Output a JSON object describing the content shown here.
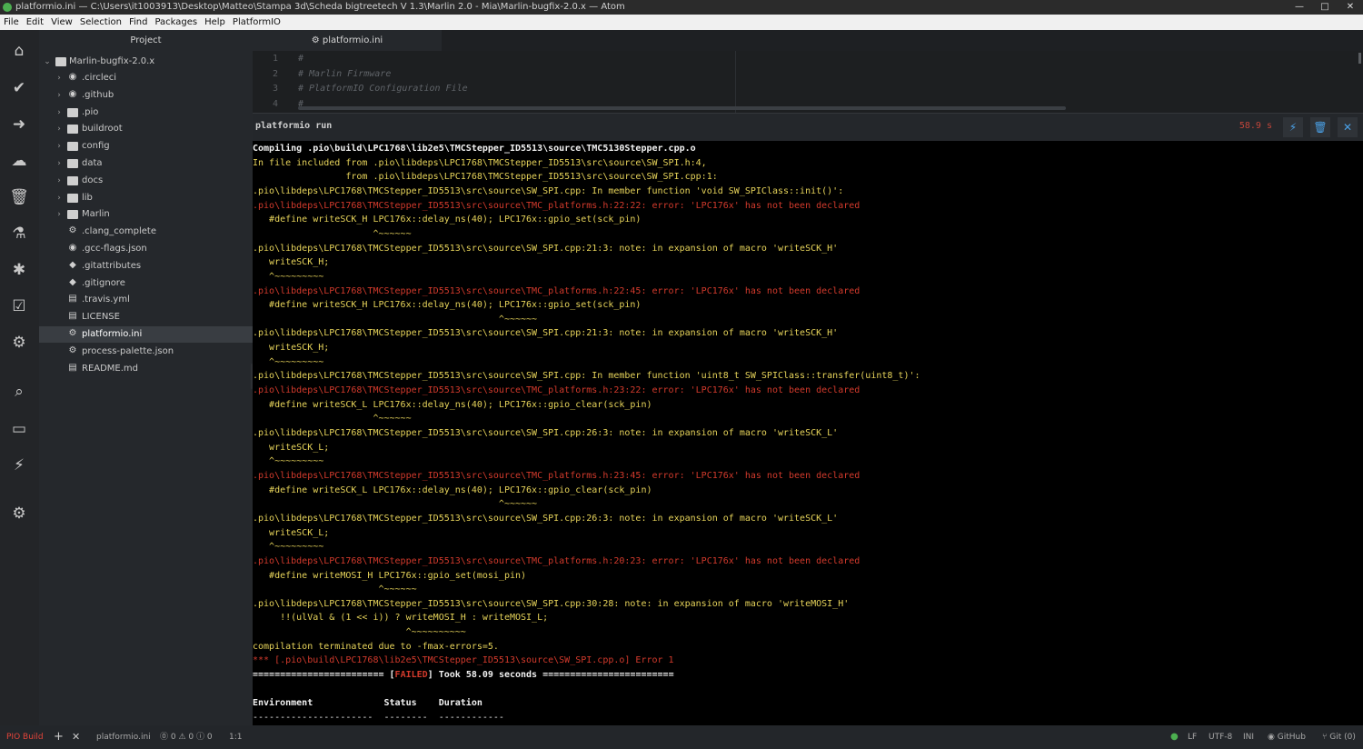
{
  "window": {
    "title": "platformio.ini — C:\\Users\\it1003913\\Desktop\\Matteo\\Stampa 3d\\Scheda bigtreetech V 1.3\\Marlin 2.0 - Mia\\Marlin-bugfix-2.0.x — Atom",
    "controls": [
      "—",
      "□",
      "✕"
    ]
  },
  "menu": [
    "File",
    "Edit",
    "View",
    "Selection",
    "Find",
    "Packages",
    "Help",
    "PlatformIO"
  ],
  "activity_icons": [
    {
      "name": "home-icon",
      "glyph": "⌂"
    },
    {
      "name": "build-check-icon",
      "glyph": "✔"
    },
    {
      "name": "upload-arrow-icon",
      "glyph": "➜"
    },
    {
      "name": "cloud-upload-icon",
      "glyph": "☁"
    },
    {
      "name": "trash-clean-icon",
      "glyph": "🗑"
    },
    {
      "name": "test-flask-icon",
      "glyph": "⚗"
    },
    {
      "name": "debug-bug-icon",
      "glyph": "✱"
    },
    {
      "name": "check-list-icon",
      "glyph": "☑"
    },
    {
      "name": "device-icon",
      "glyph": "⚙"
    },
    {
      "name": "search-icon",
      "glyph": "⌕"
    },
    {
      "name": "terminal-icon",
      "glyph": "▭"
    },
    {
      "name": "plug-icon",
      "glyph": "⚡"
    },
    {
      "name": "settings-gear-icon",
      "glyph": "⚙"
    }
  ],
  "project": {
    "header": "Project",
    "root": "Marlin-bugfix-2.0.x",
    "items": [
      {
        "label": ".circleci",
        "type": "folder",
        "glyph": "◉"
      },
      {
        "label": ".github",
        "type": "folder",
        "glyph": "◉"
      },
      {
        "label": ".pio",
        "type": "folder"
      },
      {
        "label": "buildroot",
        "type": "folder"
      },
      {
        "label": "config",
        "type": "folder"
      },
      {
        "label": "data",
        "type": "folder"
      },
      {
        "label": "docs",
        "type": "folder"
      },
      {
        "label": "lib",
        "type": "folder"
      },
      {
        "label": "Marlin",
        "type": "folder"
      },
      {
        "label": ".clang_complete",
        "type": "file",
        "glyph": "⚙"
      },
      {
        "label": ".gcc-flags.json",
        "type": "file",
        "glyph": "◉"
      },
      {
        "label": ".gitattributes",
        "type": "file",
        "glyph": "◆"
      },
      {
        "label": ".gitignore",
        "type": "file",
        "glyph": "◆"
      },
      {
        "label": ".travis.yml",
        "type": "file",
        "glyph": "▤"
      },
      {
        "label": "LICENSE",
        "type": "file",
        "glyph": "▤"
      },
      {
        "label": "platformio.ini",
        "type": "file",
        "glyph": "⚙",
        "selected": true
      },
      {
        "label": "process-palette.json",
        "type": "file",
        "glyph": "⚙"
      },
      {
        "label": "README.md",
        "type": "file",
        "glyph": "▤"
      }
    ]
  },
  "editor": {
    "tab_label": "platformio.ini",
    "lines": [
      {
        "n": "1",
        "text": "#"
      },
      {
        "n": "2",
        "text": "# Marlin Firmware"
      },
      {
        "n": "3",
        "text": "# PlatformIO Configuration File"
      },
      {
        "n": "4",
        "text": "#"
      }
    ]
  },
  "terminal": {
    "title": "platformio run",
    "elapsed": "58.9 s",
    "buttons": [
      {
        "name": "run-terminal-button",
        "glyph": "⚡"
      },
      {
        "name": "clear-terminal-button",
        "glyph": "🗑"
      },
      {
        "name": "close-terminal-button",
        "glyph": "✕"
      }
    ],
    "colors": {
      "white": "#f2f2f2",
      "yellow": "#e6d35a",
      "red": "#d23a2c"
    },
    "lines": [
      {
        "text": "Compiling .pio\\build\\LPC1768\\lib2e5\\TMCStepper_ID5513\\source\\TMC5130Stepper.cpp.o",
        "color": "white",
        "bold": true
      },
      {
        "text": "In file included from .pio\\libdeps\\LPC1768\\TMCStepper_ID5513\\src\\source\\SW_SPI.h:4,",
        "color": "yellow"
      },
      {
        "text": "                 from .pio\\libdeps\\LPC1768\\TMCStepper_ID5513\\src\\source\\SW_SPI.cpp:1:",
        "color": "yellow"
      },
      {
        "text": ".pio\\libdeps\\LPC1768\\TMCStepper_ID5513\\src\\source\\SW_SPI.cpp: In member function 'void SW_SPIClass::init()':",
        "color": "yellow"
      },
      {
        "text": ".pio\\libdeps\\LPC1768\\TMCStepper_ID5513\\src\\source\\TMC_platforms.h:22:22: error: 'LPC176x' has not been declared",
        "color": "red"
      },
      {
        "text": "   #define writeSCK_H LPC176x::delay_ns(40); LPC176x::gpio_set(sck_pin)",
        "color": "yellow"
      },
      {
        "text": "                      ^~~~~~~",
        "color": "yellow"
      },
      {
        "text": ".pio\\libdeps\\LPC1768\\TMCStepper_ID5513\\src\\source\\SW_SPI.cpp:21:3: note: in expansion of macro 'writeSCK_H'",
        "color": "yellow"
      },
      {
        "text": "   writeSCK_H;",
        "color": "yellow"
      },
      {
        "text": "   ^~~~~~~~~~",
        "color": "yellow"
      },
      {
        "text": ".pio\\libdeps\\LPC1768\\TMCStepper_ID5513\\src\\source\\TMC_platforms.h:22:45: error: 'LPC176x' has not been declared",
        "color": "red"
      },
      {
        "text": "   #define writeSCK_H LPC176x::delay_ns(40); LPC176x::gpio_set(sck_pin)",
        "color": "yellow"
      },
      {
        "text": "                                             ^~~~~~~",
        "color": "yellow"
      },
      {
        "text": ".pio\\libdeps\\LPC1768\\TMCStepper_ID5513\\src\\source\\SW_SPI.cpp:21:3: note: in expansion of macro 'writeSCK_H'",
        "color": "yellow"
      },
      {
        "text": "   writeSCK_H;",
        "color": "yellow"
      },
      {
        "text": "   ^~~~~~~~~~",
        "color": "yellow"
      },
      {
        "text": ".pio\\libdeps\\LPC1768\\TMCStepper_ID5513\\src\\source\\SW_SPI.cpp: In member function 'uint8_t SW_SPIClass::transfer(uint8_t)':",
        "color": "yellow"
      },
      {
        "text": ".pio\\libdeps\\LPC1768\\TMCStepper_ID5513\\src\\source\\TMC_platforms.h:23:22: error: 'LPC176x' has not been declared",
        "color": "red"
      },
      {
        "text": "   #define writeSCK_L LPC176x::delay_ns(40); LPC176x::gpio_clear(sck_pin)",
        "color": "yellow"
      },
      {
        "text": "                      ^~~~~~~",
        "color": "yellow"
      },
      {
        "text": ".pio\\libdeps\\LPC1768\\TMCStepper_ID5513\\src\\source\\SW_SPI.cpp:26:3: note: in expansion of macro 'writeSCK_L'",
        "color": "yellow"
      },
      {
        "text": "   writeSCK_L;",
        "color": "yellow"
      },
      {
        "text": "   ^~~~~~~~~~",
        "color": "yellow"
      },
      {
        "text": ".pio\\libdeps\\LPC1768\\TMCStepper_ID5513\\src\\source\\TMC_platforms.h:23:45: error: 'LPC176x' has not been declared",
        "color": "red"
      },
      {
        "text": "   #define writeSCK_L LPC176x::delay_ns(40); LPC176x::gpio_clear(sck_pin)",
        "color": "yellow"
      },
      {
        "text": "                                             ^~~~~~~",
        "color": "yellow"
      },
      {
        "text": ".pio\\libdeps\\LPC1768\\TMCStepper_ID5513\\src\\source\\SW_SPI.cpp:26:3: note: in expansion of macro 'writeSCK_L'",
        "color": "yellow"
      },
      {
        "text": "   writeSCK_L;",
        "color": "yellow"
      },
      {
        "text": "   ^~~~~~~~~~",
        "color": "yellow"
      },
      {
        "text": ".pio\\libdeps\\LPC1768\\TMCStepper_ID5513\\src\\source\\TMC_platforms.h:20:23: error: 'LPC176x' has not been declared",
        "color": "red"
      },
      {
        "text": "   #define writeMOSI_H LPC176x::gpio_set(mosi_pin)",
        "color": "yellow"
      },
      {
        "text": "                       ^~~~~~~",
        "color": "yellow"
      },
      {
        "text": ".pio\\libdeps\\LPC1768\\TMCStepper_ID5513\\src\\source\\SW_SPI.cpp:30:28: note: in expansion of macro 'writeMOSI_H'",
        "color": "yellow"
      },
      {
        "text": "     !!(ulVal & (1 << i)) ? writeMOSI_H : writeMOSI_L;",
        "color": "yellow"
      },
      {
        "text": "                            ^~~~~~~~~~~",
        "color": "yellow"
      },
      {
        "text": "compilation terminated due to -fmax-errors=5.",
        "color": "yellow"
      },
      {
        "text": "*** [.pio\\build\\LPC1768\\lib2e5\\TMCStepper_ID5513\\source\\SW_SPI.cpp.o] Error 1",
        "color": "red"
      },
      {
        "segments": [
          {
            "text": "======================== [",
            "color": "white"
          },
          {
            "text": "FAILED",
            "color": "red"
          },
          {
            "text": "] Took 58.09 seconds ========================",
            "color": "white"
          }
        ],
        "bold": true
      },
      {
        "text": "",
        "color": "white"
      },
      {
        "text": "Environment             Status    Duration",
        "color": "white",
        "bold": true
      },
      {
        "text": "----------------------  --------  ------------",
        "color": "white"
      }
    ]
  },
  "statusbar": {
    "build_label": "PIO Build",
    "add": "+",
    "close": "✕",
    "file": "platformio.ini",
    "diagnostics": "⓪ 0 ⚠ 0 ⓘ 0",
    "cursor": "1:1",
    "line_ending": "LF",
    "encoding": "UTF-8",
    "grammar": "INI",
    "github": "GitHub",
    "git": "Git (0)"
  }
}
